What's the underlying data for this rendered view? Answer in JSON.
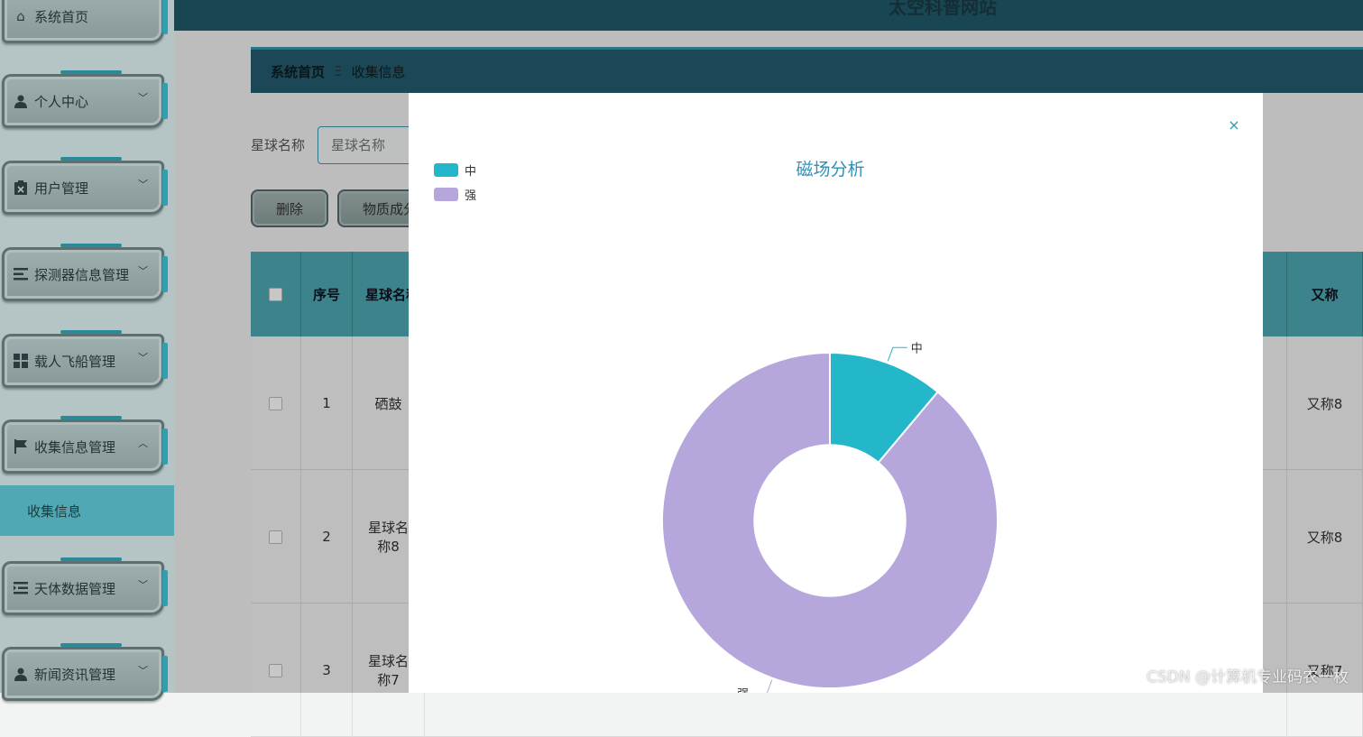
{
  "topbar": {
    "site_title": "太空科普网站"
  },
  "sidebar": {
    "items": [
      {
        "label": "系统首页",
        "icon": "home-icon"
      },
      {
        "label": "个人中心",
        "icon": "user-icon"
      },
      {
        "label": "用户管理",
        "icon": "clipboard-icon"
      },
      {
        "label": "探测器信息管理",
        "icon": "list-icon"
      },
      {
        "label": "载人飞船管理",
        "icon": "grid-icon"
      },
      {
        "label": "收集信息管理",
        "icon": "flag-icon"
      },
      {
        "label": "天体数据管理",
        "icon": "outdent-icon"
      },
      {
        "label": "新闻资讯管理",
        "icon": "user-icon"
      }
    ],
    "active_sub": "收集信息"
  },
  "breadcrumb": {
    "home": "系统首页",
    "sep": "Ξ",
    "current": "收集信息"
  },
  "search": {
    "label": "星球名称",
    "placeholder": "星球名称"
  },
  "actions": {
    "delete": "删除",
    "material": "物质成分"
  },
  "table": {
    "headers": {
      "index": "序号",
      "name": "星球名称",
      "alias": "又称"
    },
    "rows": [
      {
        "index": "1",
        "name": "硒鼓",
        "alias": "又称8"
      },
      {
        "index": "2",
        "name": "星球名称8",
        "alias": "又称8"
      },
      {
        "index": "3",
        "name": "星球名称7",
        "alias": "又称7"
      }
    ]
  },
  "modal": {
    "close": "×",
    "chart_title": "磁场分析"
  },
  "chart_data": {
    "type": "pie",
    "title": "磁场分析",
    "legend_position": "top-left",
    "series": [
      {
        "name": "中",
        "value": 1,
        "color": "#23b7c9"
      },
      {
        "name": "强",
        "value": 8,
        "color": "#b5a6dc"
      }
    ],
    "inner_radius_ratio": 0.45
  },
  "watermark": "CSDN @计算机专业码农一枚"
}
